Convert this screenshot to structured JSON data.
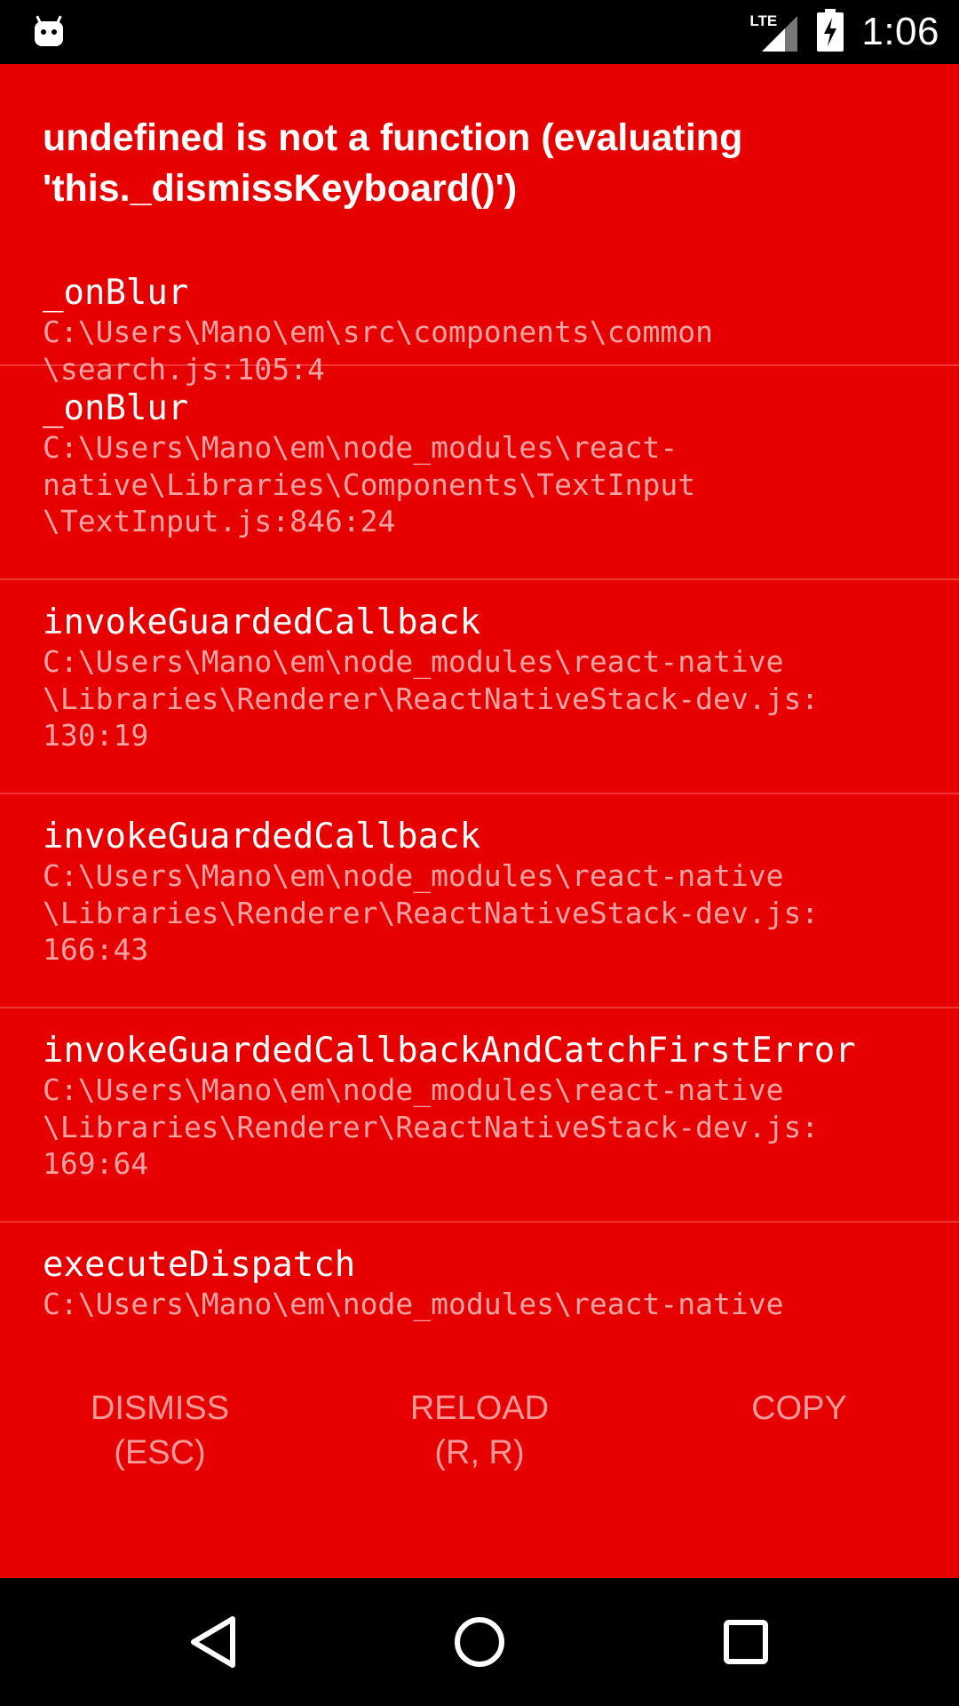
{
  "status_bar": {
    "network": "LTE",
    "time": "1:06",
    "icons": [
      "android-debug-icon",
      "lte-signal-icon",
      "battery-charging-icon"
    ]
  },
  "error": {
    "message": "undefined is not a function (evaluating 'this._dismissKeyboard()')"
  },
  "stack": [
    {
      "method": "_onBlur",
      "file": "C:\\Users\\Mano\\em\\src\\components\\common\n\\search.js:105:4"
    },
    {
      "method": "_onBlur",
      "file": "C:\\Users\\Mano\\em\\node_modules\\react-\nnative\\Libraries\\Components\\TextInput\n\\TextInput.js:846:24"
    },
    {
      "method": "invokeGuardedCallback",
      "file": "C:\\Users\\Mano\\em\\node_modules\\react-native\n\\Libraries\\Renderer\\ReactNativeStack-dev.js:\n130:19"
    },
    {
      "method": "invokeGuardedCallback",
      "file": "C:\\Users\\Mano\\em\\node_modules\\react-native\n\\Libraries\\Renderer\\ReactNativeStack-dev.js:\n166:43"
    },
    {
      "method": "invokeGuardedCallbackAndCatchFirstError",
      "file": "C:\\Users\\Mano\\em\\node_modules\\react-native\n\\Libraries\\Renderer\\ReactNativeStack-dev.js:\n169:64"
    },
    {
      "method": "executeDispatch",
      "file": "C:\\Users\\Mano\\em\\node_modules\\react-native"
    }
  ],
  "buttons": {
    "dismiss": {
      "line1": "DISMISS",
      "line2": "(ESC)"
    },
    "reload": {
      "line1": "RELOAD",
      "line2": "(R, R)"
    },
    "copy": {
      "line1": "COPY"
    }
  },
  "colors": {
    "redbox_background": "#E60000",
    "frame_file_text": "#F7A3A3",
    "button_text": "#F89A9A",
    "divider": "#F03535"
  }
}
